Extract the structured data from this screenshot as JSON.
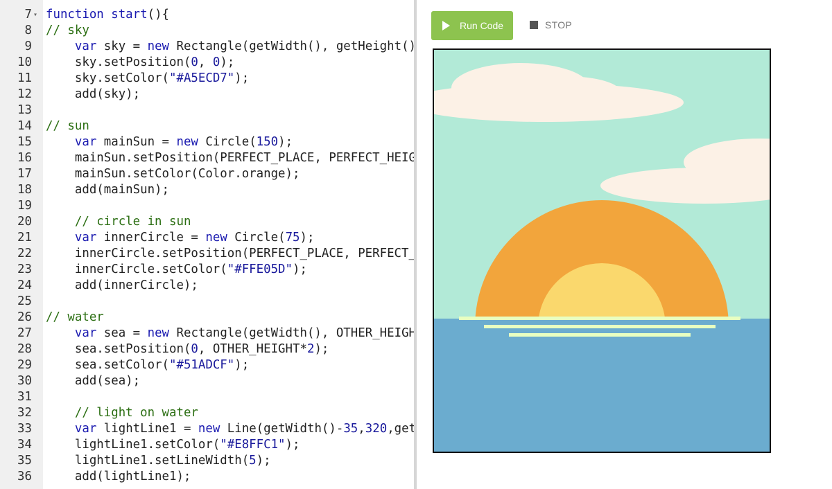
{
  "editor": {
    "lines": [
      {
        "n": "7",
        "fold": true,
        "tokens": [
          {
            "t": "kw",
            "v": "function"
          },
          {
            "t": "fn",
            "v": " start"
          },
          {
            "t": "",
            "v": "(){"
          }
        ]
      },
      {
        "n": "8",
        "tokens": [
          {
            "t": "com",
            "v": "// sky"
          }
        ]
      },
      {
        "n": "9",
        "tokens": [
          {
            "t": "",
            "v": "    "
          },
          {
            "t": "kw",
            "v": "var"
          },
          {
            "t": "",
            "v": " sky = "
          },
          {
            "t": "kw",
            "v": "new"
          },
          {
            "t": "",
            "v": " Rectangle(getWidth(), getHeight())"
          }
        ]
      },
      {
        "n": "10",
        "tokens": [
          {
            "t": "",
            "v": "    sky.setPosition("
          },
          {
            "t": "num",
            "v": "0"
          },
          {
            "t": "",
            "v": ", "
          },
          {
            "t": "num",
            "v": "0"
          },
          {
            "t": "",
            "v": ");"
          }
        ]
      },
      {
        "n": "11",
        "tokens": [
          {
            "t": "",
            "v": "    sky.setColor("
          },
          {
            "t": "str",
            "v": "\"#A5ECD7\""
          },
          {
            "t": "",
            "v": ");"
          }
        ]
      },
      {
        "n": "12",
        "tokens": [
          {
            "t": "",
            "v": "    add(sky);"
          }
        ]
      },
      {
        "n": "13",
        "tokens": []
      },
      {
        "n": "14",
        "tokens": [
          {
            "t": "com",
            "v": "// sun"
          }
        ]
      },
      {
        "n": "15",
        "tokens": [
          {
            "t": "",
            "v": "    "
          },
          {
            "t": "kw",
            "v": "var"
          },
          {
            "t": "",
            "v": " mainSun = "
          },
          {
            "t": "kw",
            "v": "new"
          },
          {
            "t": "",
            "v": " Circle("
          },
          {
            "t": "num",
            "v": "150"
          },
          {
            "t": "",
            "v": ");"
          }
        ]
      },
      {
        "n": "16",
        "tokens": [
          {
            "t": "",
            "v": "    mainSun.setPosition(PERFECT_PLACE, PERFECT_HEIGHT"
          }
        ]
      },
      {
        "n": "17",
        "tokens": [
          {
            "t": "",
            "v": "    mainSun.setColor(Color.orange);"
          }
        ]
      },
      {
        "n": "18",
        "tokens": [
          {
            "t": "",
            "v": "    add(mainSun);"
          }
        ]
      },
      {
        "n": "19",
        "tokens": []
      },
      {
        "n": "20",
        "tokens": [
          {
            "t": "",
            "v": "    "
          },
          {
            "t": "com",
            "v": "// circle in sun"
          }
        ]
      },
      {
        "n": "21",
        "tokens": [
          {
            "t": "",
            "v": "    "
          },
          {
            "t": "kw",
            "v": "var"
          },
          {
            "t": "",
            "v": " innerCircle = "
          },
          {
            "t": "kw",
            "v": "new"
          },
          {
            "t": "",
            "v": " Circle("
          },
          {
            "t": "num",
            "v": "75"
          },
          {
            "t": "",
            "v": ");"
          }
        ]
      },
      {
        "n": "22",
        "tokens": [
          {
            "t": "",
            "v": "    innerCircle.setPosition(PERFECT_PLACE, PERFECT_H"
          }
        ]
      },
      {
        "n": "23",
        "tokens": [
          {
            "t": "",
            "v": "    innerCircle.setColor("
          },
          {
            "t": "str",
            "v": "\"#FFE05D\""
          },
          {
            "t": "",
            "v": ");"
          }
        ]
      },
      {
        "n": "24",
        "tokens": [
          {
            "t": "",
            "v": "    add(innerCircle);"
          }
        ]
      },
      {
        "n": "25",
        "tokens": []
      },
      {
        "n": "26",
        "tokens": [
          {
            "t": "com",
            "v": "// water"
          }
        ]
      },
      {
        "n": "27",
        "tokens": [
          {
            "t": "",
            "v": "    "
          },
          {
            "t": "kw",
            "v": "var"
          },
          {
            "t": "",
            "v": " sea = "
          },
          {
            "t": "kw",
            "v": "new"
          },
          {
            "t": "",
            "v": " Rectangle(getWidth(), OTHER_HEIGHT"
          }
        ]
      },
      {
        "n": "28",
        "tokens": [
          {
            "t": "",
            "v": "    sea.setPosition("
          },
          {
            "t": "num",
            "v": "0"
          },
          {
            "t": "",
            "v": ", OTHER_HEIGHT*"
          },
          {
            "t": "num",
            "v": "2"
          },
          {
            "t": "",
            "v": ");"
          }
        ]
      },
      {
        "n": "29",
        "tokens": [
          {
            "t": "",
            "v": "    sea.setColor("
          },
          {
            "t": "str",
            "v": "\"#51ADCF\""
          },
          {
            "t": "",
            "v": ");"
          }
        ]
      },
      {
        "n": "30",
        "tokens": [
          {
            "t": "",
            "v": "    add(sea);"
          }
        ]
      },
      {
        "n": "31",
        "tokens": []
      },
      {
        "n": "32",
        "tokens": [
          {
            "t": "",
            "v": "    "
          },
          {
            "t": "com",
            "v": "// light on water"
          }
        ]
      },
      {
        "n": "33",
        "tokens": [
          {
            "t": "",
            "v": "    "
          },
          {
            "t": "kw",
            "v": "var"
          },
          {
            "t": "",
            "v": " lightLine1 = "
          },
          {
            "t": "kw",
            "v": "new"
          },
          {
            "t": "",
            "v": " Line(getWidth()-"
          },
          {
            "t": "num",
            "v": "35"
          },
          {
            "t": "",
            "v": ","
          },
          {
            "t": "num",
            "v": "320"
          },
          {
            "t": "",
            "v": ",getW"
          }
        ]
      },
      {
        "n": "34",
        "tokens": [
          {
            "t": "",
            "v": "    lightLine1.setColor("
          },
          {
            "t": "str",
            "v": "\"#E8FFC1\""
          },
          {
            "t": "",
            "v": ");"
          }
        ]
      },
      {
        "n": "35",
        "tokens": [
          {
            "t": "",
            "v": "    lightLine1.setLineWidth("
          },
          {
            "t": "num",
            "v": "5"
          },
          {
            "t": "",
            "v": ");"
          }
        ]
      },
      {
        "n": "36",
        "tokens": [
          {
            "t": "",
            "v": "    add(lightLine1);"
          }
        ]
      }
    ]
  },
  "toolbar": {
    "run_label": "Run Code",
    "stop_label": "STOP"
  },
  "colors": {
    "run_button": "#8DC34F",
    "sky": "#B2EAD7",
    "sea": "#6BACCF",
    "sun_outer": "#F2A53C",
    "sun_inner": "#FAD86D",
    "light_lines": "#E8FFC1",
    "clouds": "#FCF1E6"
  },
  "icons": {
    "run": "play-icon",
    "stop": "stop-icon",
    "fold": "fold-arrow-icon"
  }
}
